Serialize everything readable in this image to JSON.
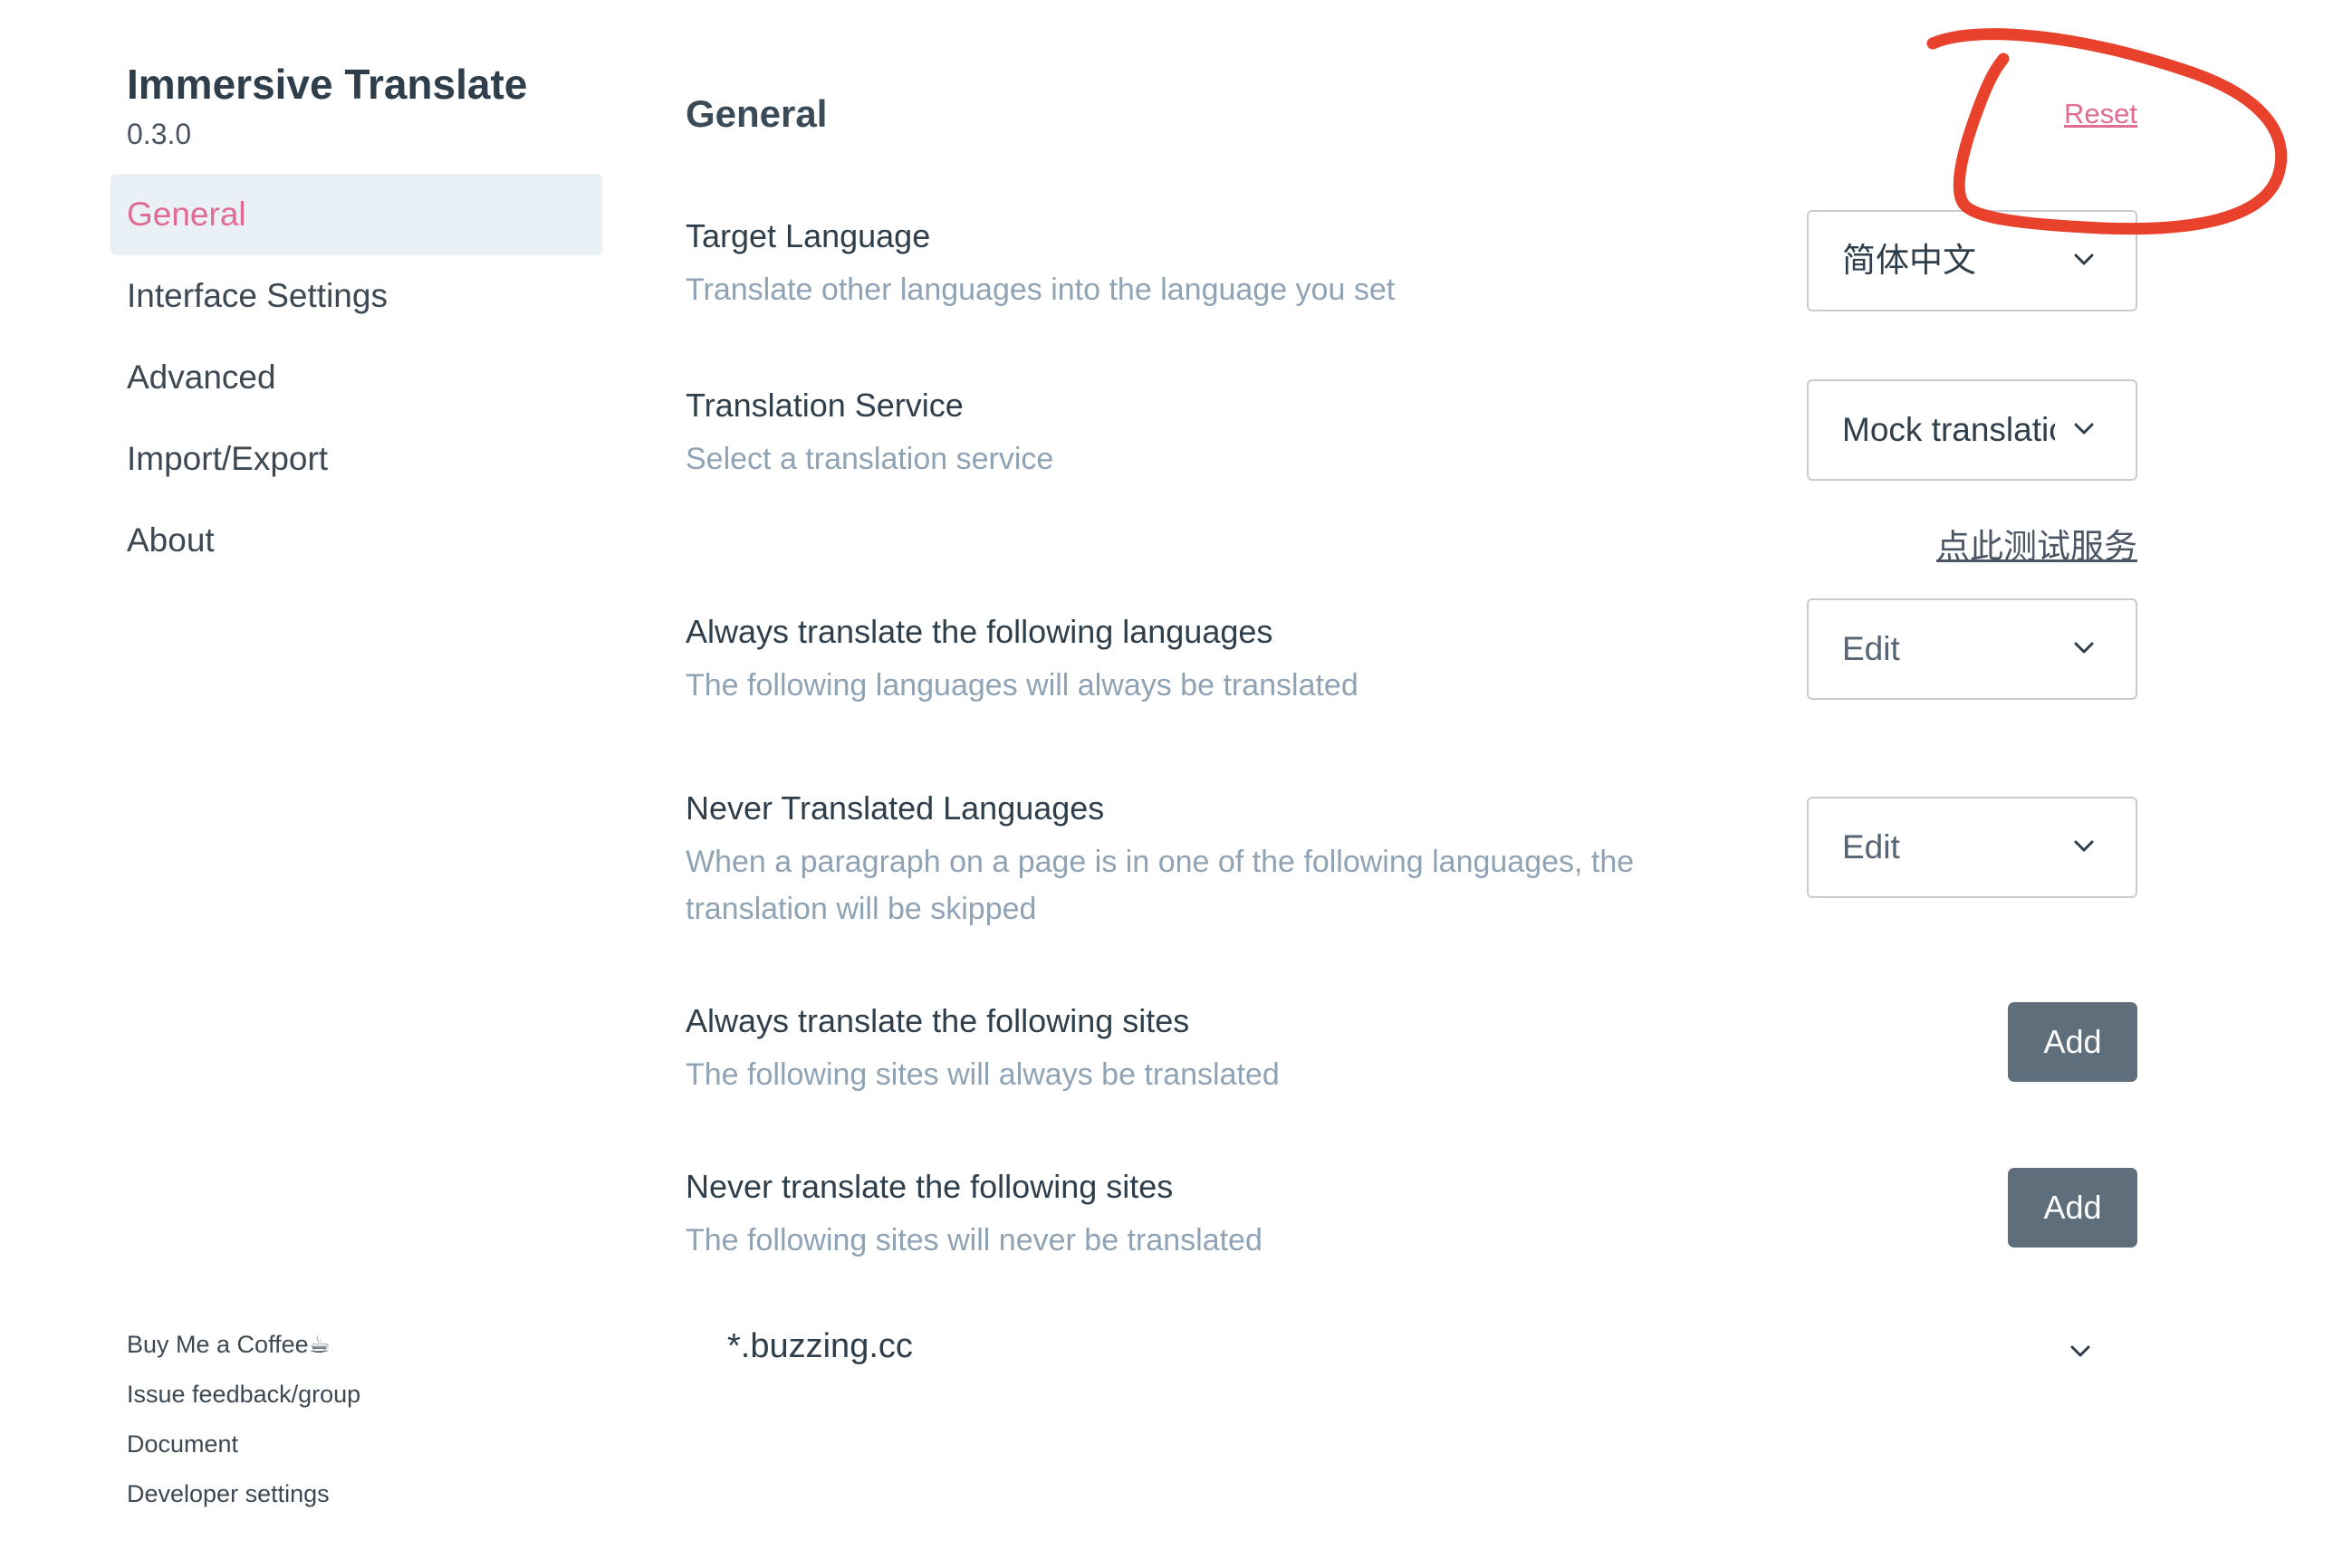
{
  "app": {
    "title": "Immersive Translate",
    "version": "0.3.0"
  },
  "nav": {
    "items": [
      {
        "label": "General",
        "active": true
      },
      {
        "label": "Interface Settings",
        "active": false
      },
      {
        "label": "Advanced",
        "active": false
      },
      {
        "label": "Import/Export",
        "active": false
      },
      {
        "label": "About",
        "active": false
      }
    ]
  },
  "footer": {
    "links": [
      "Buy Me a Coffee☕",
      "Issue feedback/group",
      "Document",
      "Developer settings"
    ]
  },
  "main": {
    "title": "General",
    "reset_label": "Reset",
    "settings": {
      "target_language": {
        "label": "Target Language",
        "description": "Translate other languages into the language you set",
        "value": "简体中文"
      },
      "translation_service": {
        "label": "Translation Service",
        "description": "Select a translation service",
        "value": "Mock translation",
        "test_link": "点此测试服务"
      },
      "always_translate_languages": {
        "label": "Always translate the following languages",
        "description": "The following languages will always be translated",
        "value": "Edit"
      },
      "never_translate_languages": {
        "label": "Never Translated Languages",
        "description": "When a paragraph on a page is in one of the following languages, the translation will be skipped",
        "value": "Edit"
      },
      "always_translate_sites": {
        "label": "Always translate the following sites",
        "description": "The following sites will always be translated",
        "button": "Add"
      },
      "never_translate_sites": {
        "label": "Never translate the following sites",
        "description": "The following sites will never be translated",
        "button": "Add",
        "sites": [
          "*.buzzing.cc"
        ]
      }
    }
  },
  "colors": {
    "accent": "#e06c92",
    "active_bg": "#e9f1f6",
    "description": "#8fa3b5",
    "button_bg": "#5f6e7b",
    "annotation": "#e8412c"
  }
}
